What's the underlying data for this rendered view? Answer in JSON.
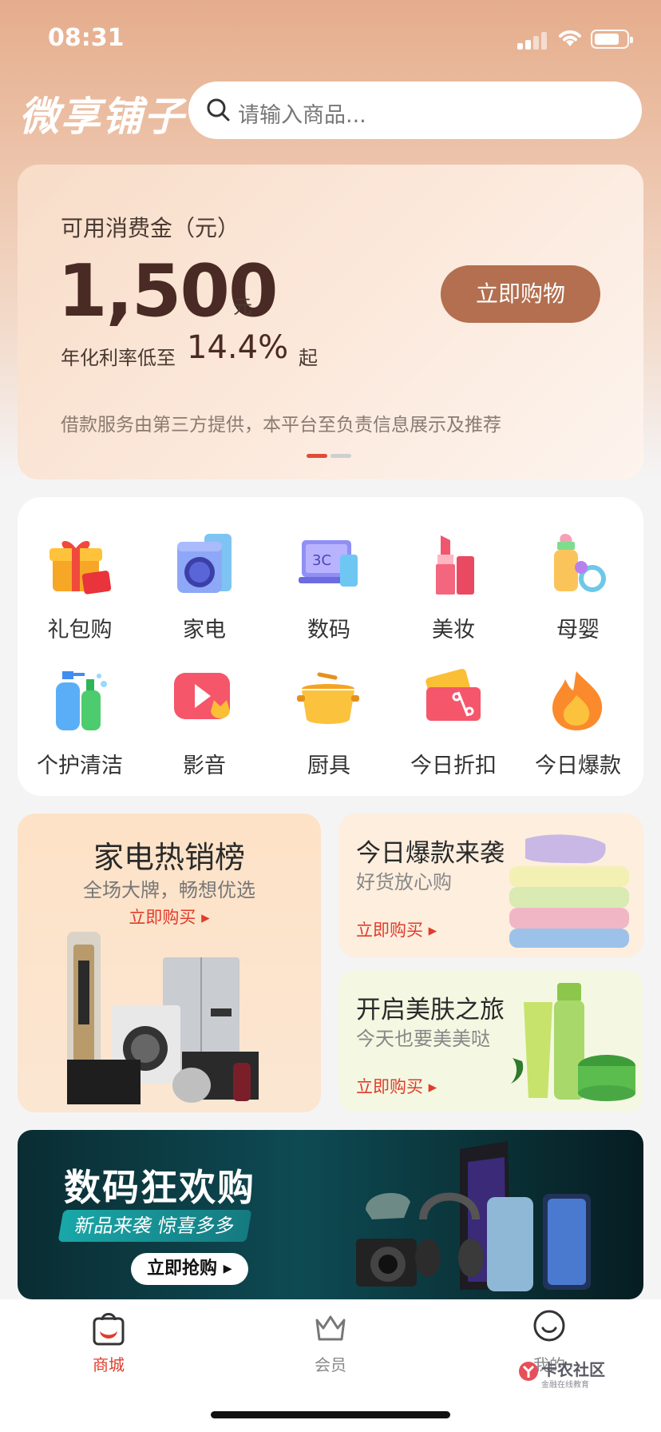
{
  "status_bar": {
    "time": "08:31"
  },
  "header": {
    "logo": "微享铺子",
    "search_placeholder": "请输入商品..."
  },
  "credit_card": {
    "label": "可用消费金（元）",
    "amount": "1,500",
    "unit": "元",
    "rate_label": "年化利率低至",
    "rate": "14.4%",
    "rate_suffix": "起",
    "button": "立即购物",
    "disclaimer": "借款服务由第三方提供，本平台至负责信息展示及推荐",
    "carousel_active_index": 0,
    "carousel_count": 2
  },
  "categories": [
    {
      "label": "礼包购",
      "icon": "gift-icon"
    },
    {
      "label": "家电",
      "icon": "washing-machine-icon"
    },
    {
      "label": "数码",
      "icon": "laptop-icon"
    },
    {
      "label": "美妆",
      "icon": "lipstick-icon"
    },
    {
      "label": "母婴",
      "icon": "baby-bottle-icon"
    },
    {
      "label": "个护清洁",
      "icon": "cleaning-bottles-icon"
    },
    {
      "label": "影音",
      "icon": "video-play-icon"
    },
    {
      "label": "厨具",
      "icon": "cooking-pot-icon"
    },
    {
      "label": "今日折扣",
      "icon": "discount-coupon-icon"
    },
    {
      "label": "今日爆款",
      "icon": "flame-icon"
    }
  ],
  "promos": {
    "appliances": {
      "title": "家电热销榜",
      "subtitle": "全场大牌，畅想优选",
      "cta": "立即购买"
    },
    "hot": {
      "title": "今日爆款来袭",
      "subtitle": "好货放心购",
      "cta": "立即购买"
    },
    "skincare": {
      "title": "开启美肤之旅",
      "subtitle": "今天也要美美哒",
      "cta": "立即购买"
    }
  },
  "digital_banner": {
    "title": "数码狂欢购",
    "tagline": "新品来袭 惊喜多多",
    "cta": "立即抢购"
  },
  "bottom_nav": [
    {
      "label": "商城",
      "icon": "shopping-bag-icon",
      "active": true
    },
    {
      "label": "会员",
      "icon": "crown-icon",
      "active": false
    },
    {
      "label": "我的",
      "icon": "smiley-face-icon",
      "active": false
    }
  ],
  "watermark": {
    "title": "卡农社区",
    "subtitle": "金融在线教育"
  },
  "colors": {
    "accent": "#b36f4f",
    "active_tab": "#e03c2a",
    "inactive_tab": "#888888",
    "cta_red": "#e03c2a"
  }
}
